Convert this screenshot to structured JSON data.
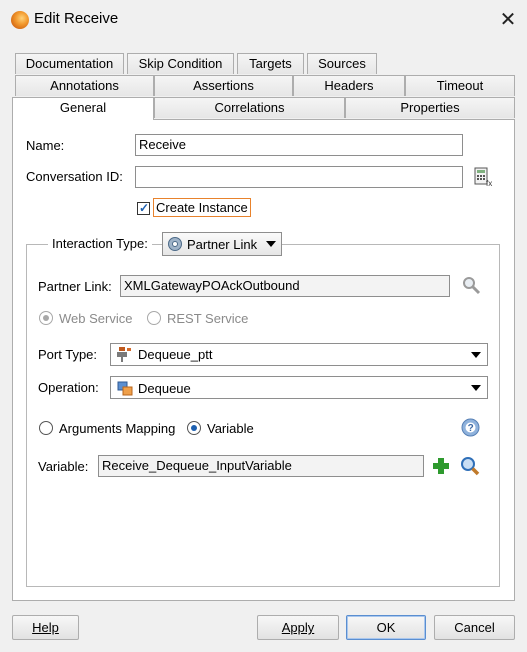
{
  "window": {
    "title": "Edit Receive",
    "close_symbol": "✕"
  },
  "tabs": {
    "row1": [
      "Documentation",
      "Skip Condition",
      "Targets",
      "Sources"
    ],
    "row2": [
      "Annotations",
      "Assertions",
      "Headers",
      "Timeout"
    ],
    "row3": [
      "General",
      "Correlations",
      "Properties"
    ],
    "active": "General"
  },
  "general": {
    "name_label": "Name:",
    "name_value": "Receive",
    "conversation_id_label": "Conversation ID:",
    "conversation_id_value": "",
    "create_instance_label": "Create Instance",
    "create_instance_checked": true
  },
  "interaction": {
    "type_label": "Interaction Type:",
    "type_value": "Partner Link",
    "partner_link_label": "Partner Link:",
    "partner_link_value": "XMLGatewayPOAckOutbound",
    "web_service_label": "Web Service",
    "rest_service_label": "REST Service",
    "port_type_label": "Port Type:",
    "port_type_value": "Dequeue_ptt",
    "operation_label": "Operation:",
    "operation_value": "Dequeue",
    "arguments_mapping_label": "Arguments Mapping",
    "variable_radio_label": "Variable",
    "variable_label": "Variable:",
    "variable_value": "Receive_Dequeue_InputVariable"
  },
  "buttons": {
    "help": "Help",
    "apply": "Apply",
    "ok": "OK",
    "cancel": "Cancel"
  },
  "colors": {
    "accent": "#1c5fb0",
    "focus_border": "#e8822c",
    "add_green": "#2e9a2e"
  }
}
